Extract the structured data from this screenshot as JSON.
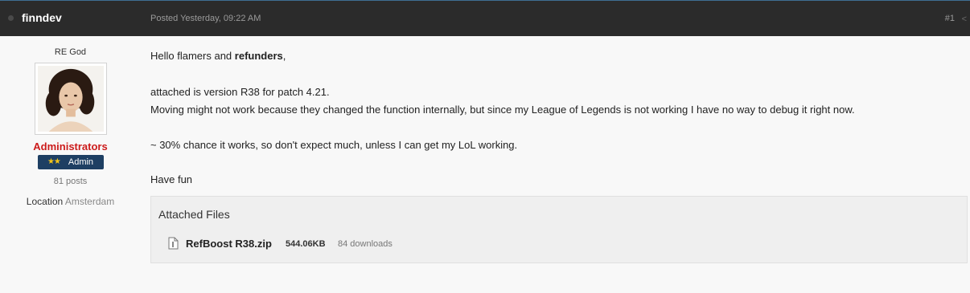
{
  "post": {
    "username": "finndev",
    "posted": "Posted Yesterday, 09:22 AM",
    "number": "#1",
    "icons": {
      "status": "status-dot-icon",
      "share": "share-icon"
    }
  },
  "author": {
    "rank_title": "RE God",
    "avatar": "portrait avatar",
    "group": "Administrators",
    "group_color": "#cc1b1b",
    "badge_label": "Admin",
    "badge_stars": "★★",
    "posts": "81 posts",
    "location_label": "Location",
    "location_value": "Amsterdam"
  },
  "body": {
    "greeting_prefix": "Hello flamers and ",
    "greeting_bold": "refunders",
    "greeting_suffix": ",",
    "line2": "attached is version R38 for patch 4.21.",
    "line3": "Moving might not work because they changed the function internally, but since my League of Legends is not working I have no way to debug it right now.",
    "line4": "~ 30% chance it works, so don't expect much, unless I can get my LoL working.",
    "line5": "Have fun"
  },
  "attachments": {
    "title": "Attached Files",
    "files": [
      {
        "icon": "file-icon",
        "name": "RefBoost R38.zip",
        "size": "544.06KB",
        "downloads": "84 downloads"
      }
    ]
  },
  "colors": {
    "header_bg": "#2b2b2b",
    "badge_bg": "#1e3f63",
    "page_bg": "#f8f8f8"
  }
}
